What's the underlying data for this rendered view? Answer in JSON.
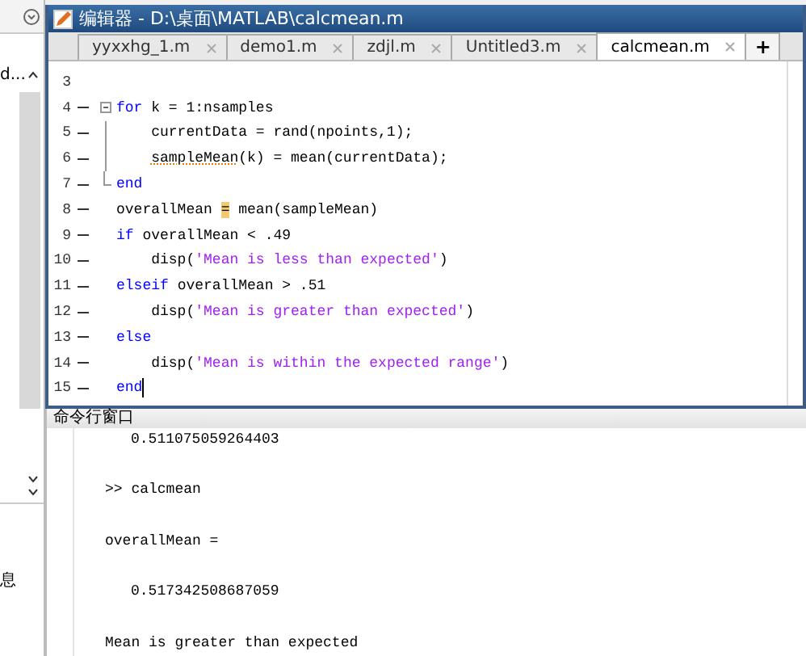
{
  "left_panel": {
    "item_text": "d...",
    "footer_text": "息"
  },
  "editor": {
    "title": "编辑器 - D:\\桌面\\MATLAB\\calcmean.m",
    "tabs": [
      {
        "label": "yyxxhg_1.m",
        "selected": false
      },
      {
        "label": "demo1.m",
        "selected": false
      },
      {
        "label": "zdjl.m",
        "selected": false
      },
      {
        "label": "Untitled3.m",
        "selected": false
      },
      {
        "label": "calcmean.m",
        "selected": true
      }
    ],
    "new_tab": "+",
    "lines": [
      {
        "number": "3",
        "kind": "plain",
        "executable": false,
        "cursor": false
      },
      {
        "number": "4",
        "executable": true,
        "cursor": false,
        "kind": "foldstart",
        "segments": [
          {
            "kind": "kw",
            "text": "for"
          },
          {
            "kind": "plain",
            "text": " k = 1:nsamples"
          }
        ]
      },
      {
        "number": "5",
        "executable": true,
        "cursor": false,
        "kind": "foldbody",
        "segments": [
          {
            "kind": "plain",
            "text": "    currentData = rand(npoints,1);"
          }
        ]
      },
      {
        "number": "6",
        "executable": true,
        "cursor": false,
        "kind": "foldbody",
        "segments": [
          {
            "kind": "warn",
            "text": "    sampleMean"
          },
          {
            "kind": "plain",
            "text": "(k) = mean(currentData);"
          }
        ]
      },
      {
        "number": "7",
        "executable": true,
        "cursor": false,
        "kind": "foldend",
        "segments": [
          {
            "kind": "kw",
            "text": "end"
          }
        ]
      },
      {
        "number": "8",
        "kind": "plain",
        "executable": true,
        "cursor": false,
        "segments": [
          {
            "kind": "plain",
            "text": "overallMean "
          },
          {
            "kind": "mark",
            "text": "="
          },
          {
            "kind": "plain",
            "text": " mean(sampleMean)"
          }
        ]
      },
      {
        "number": "9",
        "kind": "plain",
        "executable": true,
        "cursor": false,
        "segments": [
          {
            "kind": "kw",
            "text": "if"
          },
          {
            "kind": "plain",
            "text": " overallMean < .49"
          }
        ]
      },
      {
        "number": "10",
        "kind": "plain",
        "executable": true,
        "cursor": false,
        "segments": [
          {
            "kind": "plain",
            "text": "    disp("
          },
          {
            "kind": "str",
            "text": "'Mean is less than expected'"
          },
          {
            "kind": "plain",
            "text": ")"
          }
        ]
      },
      {
        "number": "11",
        "kind": "plain",
        "executable": true,
        "cursor": false,
        "segments": [
          {
            "kind": "kw",
            "text": "elseif"
          },
          {
            "kind": "plain",
            "text": " overallMean > .51"
          }
        ]
      },
      {
        "number": "12",
        "kind": "plain",
        "executable": true,
        "cursor": false,
        "segments": [
          {
            "kind": "plain",
            "text": "    disp("
          },
          {
            "kind": "str",
            "text": "'Mean is greater than expected'"
          },
          {
            "kind": "plain",
            "text": ")"
          }
        ]
      },
      {
        "number": "13",
        "kind": "plain",
        "executable": true,
        "cursor": false,
        "segments": [
          {
            "kind": "kw",
            "text": "else"
          }
        ]
      },
      {
        "number": "14",
        "kind": "plain",
        "executable": true,
        "cursor": false,
        "segments": [
          {
            "kind": "plain",
            "text": "    disp("
          },
          {
            "kind": "str",
            "text": "'Mean is within the expected range'"
          },
          {
            "kind": "plain",
            "text": ")"
          }
        ]
      },
      {
        "number": "15",
        "kind": "plain",
        "executable": true,
        "cursor": true,
        "segments": [
          {
            "kind": "kw",
            "text": "end"
          }
        ]
      }
    ]
  },
  "command_window": {
    "title": "命令行窗口",
    "lines": [
      {
        "kind": "value",
        "text": "0.511075059264403"
      },
      {
        "kind": "plain",
        "text": ">> calcmean"
      },
      {
        "kind": "plain",
        "text": "overallMean ="
      },
      {
        "kind": "value",
        "text": "0.517342508687059"
      },
      {
        "kind": "plain",
        "text": "Mean is greater than expected"
      }
    ]
  }
}
